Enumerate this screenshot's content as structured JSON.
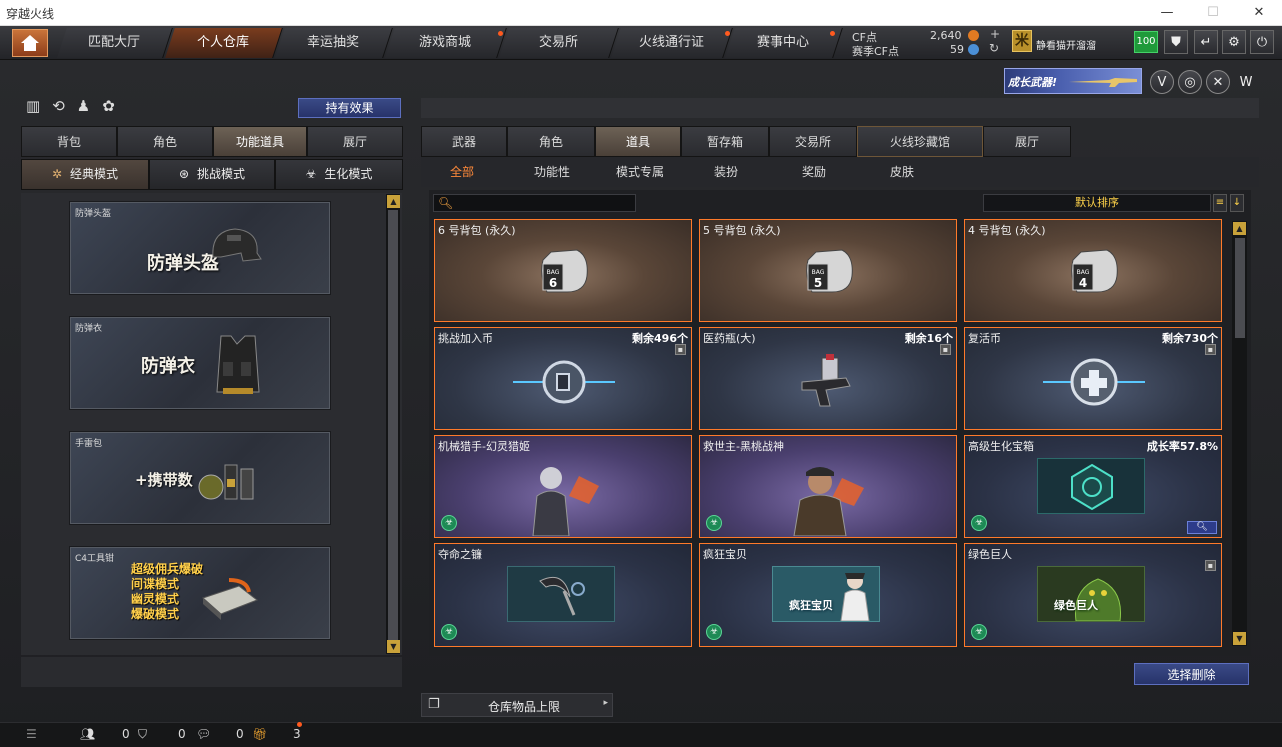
{
  "window": {
    "title": "穿越火线",
    "controls": [
      "—",
      "☐",
      "✕"
    ]
  },
  "nav": {
    "tabs": [
      {
        "label": "匹配大厅",
        "active": false,
        "dot": false
      },
      {
        "label": "个人仓库",
        "active": true,
        "dot": false
      },
      {
        "label": "幸运抽奖",
        "active": false,
        "dot": false
      },
      {
        "label": "游戏商城",
        "active": false,
        "dot": true
      },
      {
        "label": "交易所",
        "active": false,
        "dot": false
      },
      {
        "label": "火线通行证",
        "active": false,
        "dot": true
      },
      {
        "label": "赛事中心",
        "active": false,
        "dot": true
      }
    ],
    "cf_label": "CF点",
    "cf_value": "2,640",
    "season_label": "赛季CF点",
    "season_value": "59",
    "promo": "静看猫开溜溜",
    "level": "100",
    "banner": "成长武器!"
  },
  "left": {
    "hold_effect": "持有效果",
    "tabs": [
      "背包",
      "角色",
      "功能道具",
      "展厅"
    ],
    "active_tab": 2,
    "modes": [
      "经典模式",
      "挑战模式",
      "生化模式"
    ],
    "active_mode": 0,
    "cards": [
      {
        "label": "防弹头盔",
        "big": "防弹头盔"
      },
      {
        "label": "防弹衣",
        "big": "防弹衣"
      },
      {
        "label": "手雷包",
        "big": "+携带数"
      },
      {
        "label": "C4工具钳",
        "lines": [
          "超级佣兵爆破",
          "间谍模式",
          "幽灵模式",
          "爆破模式"
        ]
      }
    ]
  },
  "right": {
    "tabs": [
      "武器",
      "角色",
      "道具",
      "暂存箱",
      "交易所",
      "火线珍藏馆",
      "展厅"
    ],
    "active_tab": 2,
    "subtabs": [
      "全部",
      "功能性",
      "模式专属",
      "装扮",
      "奖励",
      "皮肤"
    ],
    "active_subtab": 0,
    "search_placeholder": "",
    "sort_label": "默认排序",
    "items": [
      {
        "name": "6 号背包 (永久)",
        "count": "",
        "style": "bag",
        "bag_num": "6",
        "trash": false,
        "bio": false
      },
      {
        "name": "5 号背包 (永久)",
        "count": "",
        "style": "bag",
        "bag_num": "5",
        "trash": false,
        "bio": false
      },
      {
        "name": "4 号背包 (永久)",
        "count": "",
        "style": "bag",
        "bag_num": "4",
        "trash": false,
        "bio": false
      },
      {
        "name": "挑战加入币",
        "count": "剩余496个",
        "style": "blue",
        "trash": true,
        "bio": false
      },
      {
        "name": "医药瓶(大)",
        "count": "剩余16个",
        "style": "blue",
        "trash": true,
        "bio": false
      },
      {
        "name": "复活币",
        "count": "剩余730个",
        "style": "blue",
        "trash": true,
        "bio": false
      },
      {
        "name": "机械猎手-幻灵猎姬",
        "count": "",
        "style": "purple",
        "trash": false,
        "bio": true
      },
      {
        "name": "救世主-黑桃战神",
        "count": "",
        "style": "purple",
        "trash": false,
        "bio": true
      },
      {
        "name": "高级生化宝箱",
        "count": "成长率57.8%",
        "style": "navy",
        "trash": false,
        "bio": true,
        "search": true
      },
      {
        "name": "夺命之镰",
        "count": "",
        "style": "navy",
        "trash": false,
        "bio": true
      },
      {
        "name": "疯狂宝贝",
        "count": "",
        "style": "navy",
        "trash": false,
        "bio": true,
        "thumb_text": "疯狂宝贝"
      },
      {
        "name": "绿色巨人",
        "count": "",
        "style": "navy",
        "trash": true,
        "bio": true,
        "thumb_text": "绿色巨人"
      }
    ],
    "delete_button": "选择删除",
    "capacity_label": "仓库物品上限"
  },
  "bottom": {
    "friends": "0",
    "shield": "0",
    "chat": "0",
    "gift": "3"
  },
  "colors": {
    "accent": "#ff7a2a",
    "active_tab": "#6d6256",
    "button": "#27336a"
  }
}
